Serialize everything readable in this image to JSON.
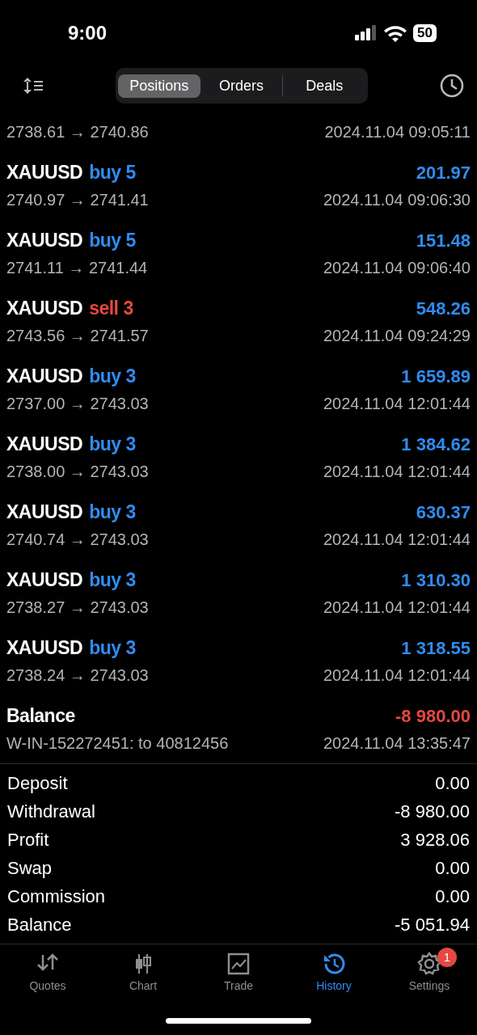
{
  "status_bar": {
    "time": "9:00",
    "battery": "50"
  },
  "tabs": [
    {
      "label": "Positions",
      "selected": true
    },
    {
      "label": "Orders",
      "selected": false
    },
    {
      "label": "Deals",
      "selected": false
    }
  ],
  "deals": [
    {
      "kind": "partial",
      "prices": "2738.61 → 2740.86",
      "time": "2024.11.04 09:05:11"
    },
    {
      "kind": "trade",
      "symbol": "XAUUSD",
      "side": "buy 5",
      "color": "#2f8cf0",
      "profit": "201.97",
      "loss": false,
      "prices": "2740.97 → 2741.41",
      "time": "2024.11.04 09:06:30"
    },
    {
      "kind": "trade",
      "symbol": "XAUUSD",
      "side": "buy 5",
      "color": "#2f8cf0",
      "profit": "151.48",
      "loss": false,
      "prices": "2741.11 → 2741.44",
      "time": "2024.11.04 09:06:40"
    },
    {
      "kind": "trade",
      "symbol": "XAUUSD",
      "side": "sell 3",
      "color": "#e5483f",
      "profit": "548.26",
      "loss": false,
      "prices": "2743.56 → 2741.57",
      "time": "2024.11.04 09:24:29"
    },
    {
      "kind": "trade",
      "symbol": "XAUUSD",
      "side": "buy 3",
      "color": "#2f8cf0",
      "profit": "1 659.89",
      "loss": false,
      "prices": "2737.00 → 2743.03",
      "time": "2024.11.04 12:01:44"
    },
    {
      "kind": "trade",
      "symbol": "XAUUSD",
      "side": "buy 3",
      "color": "#2f8cf0",
      "profit": "1 384.62",
      "loss": false,
      "prices": "2738.00 → 2743.03",
      "time": "2024.11.04 12:01:44"
    },
    {
      "kind": "trade",
      "symbol": "XAUUSD",
      "side": "buy 3",
      "color": "#2f8cf0",
      "profit": "630.37",
      "loss": false,
      "prices": "2740.74 → 2743.03",
      "time": "2024.11.04 12:01:44"
    },
    {
      "kind": "trade",
      "symbol": "XAUUSD",
      "side": "buy 3",
      "color": "#2f8cf0",
      "profit": "1 310.30",
      "loss": false,
      "prices": "2738.27 → 2743.03",
      "time": "2024.11.04 12:01:44"
    },
    {
      "kind": "trade",
      "symbol": "XAUUSD",
      "side": "buy 3",
      "color": "#2f8cf0",
      "profit": "1 318.55",
      "loss": false,
      "prices": "2738.24 → 2743.03",
      "time": "2024.11.04 12:01:44"
    },
    {
      "kind": "balance",
      "symbol": "Balance",
      "profit": "-8 980.00",
      "loss": true,
      "prices": "W-IN-152272451: to 40812456",
      "time": "2024.11.04 13:35:47"
    }
  ],
  "summary": [
    {
      "label": "Deposit",
      "value": "0.00"
    },
    {
      "label": "Withdrawal",
      "value": "-8 980.00"
    },
    {
      "label": "Profit",
      "value": "3 928.06"
    },
    {
      "label": "Swap",
      "value": "0.00"
    },
    {
      "label": "Commission",
      "value": "0.00"
    },
    {
      "label": "Balance",
      "value": "-5 051.94"
    }
  ],
  "bottom_nav": [
    {
      "label": "Quotes",
      "selected": false
    },
    {
      "label": "Chart",
      "selected": false
    },
    {
      "label": "Trade",
      "selected": false
    },
    {
      "label": "History",
      "selected": true
    },
    {
      "label": "Settings",
      "selected": false,
      "badge": "1"
    }
  ]
}
